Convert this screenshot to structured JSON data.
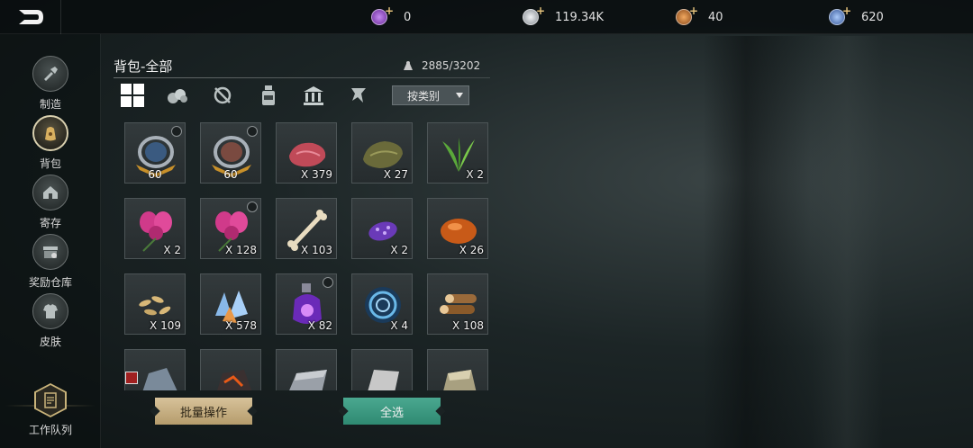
{
  "topbar": {
    "currencies": [
      {
        "icon": "purple-gem-icon",
        "value": "0",
        "color": "#9a5bd0"
      },
      {
        "icon": "silver-coin-icon",
        "value": "119.34K",
        "color": "#c8ccd0"
      },
      {
        "icon": "copper-coin-icon",
        "value": "40",
        "color": "#d08040"
      },
      {
        "icon": "blue-crystal-icon",
        "value": "620",
        "color": "#6a9ad8"
      }
    ]
  },
  "sidebar": {
    "items": [
      {
        "label": "制造",
        "icon": "crafting-icon"
      },
      {
        "label": "背包",
        "icon": "backpack-icon"
      },
      {
        "label": "寄存",
        "icon": "storage-house-icon"
      },
      {
        "label": "奖励仓库",
        "icon": "reward-warehouse-icon"
      },
      {
        "label": "皮肤",
        "icon": "skin-armor-icon"
      }
    ],
    "queue_label": "工作队列"
  },
  "panel": {
    "title": "背包-全部",
    "capacity": "2885/3202",
    "sort_label": "按类别",
    "tabs": [
      "all-grid-icon",
      "materials-icon",
      "equipment-icon",
      "consumables-icon",
      "buildings-icon",
      "misc-icon"
    ]
  },
  "items": [
    {
      "name": "armor-badge-1",
      "label": "60",
      "type": "level"
    },
    {
      "name": "armor-badge-2",
      "label": "60",
      "type": "level"
    },
    {
      "name": "raw-meat",
      "label": "X 379",
      "type": "qty"
    },
    {
      "name": "animal-hide",
      "label": "X 27",
      "type": "qty"
    },
    {
      "name": "green-herb",
      "label": "X 2",
      "type": "qty"
    },
    {
      "name": "pink-orchid",
      "label": "X 2",
      "type": "qty"
    },
    {
      "name": "pink-orchid-2",
      "label": "X 128",
      "type": "qty"
    },
    {
      "name": "bone",
      "label": "X 103",
      "type": "qty"
    },
    {
      "name": "purple-spotted-fruit",
      "label": "X 2",
      "type": "qty"
    },
    {
      "name": "amber-resin",
      "label": "X 26",
      "type": "qty"
    },
    {
      "name": "grain-seeds",
      "label": "X 109",
      "type": "qty"
    },
    {
      "name": "crystal-shards",
      "label": "X 578",
      "type": "qty"
    },
    {
      "name": "purple-potion",
      "label": "X 82",
      "type": "qty"
    },
    {
      "name": "blue-vortex-orb",
      "label": "X 4",
      "type": "qty"
    },
    {
      "name": "wood-logs",
      "label": "X 108",
      "type": "qty"
    },
    {
      "name": "stone-ore",
      "label": "",
      "type": "qty"
    },
    {
      "name": "lava-ore",
      "label": "",
      "type": "qty"
    },
    {
      "name": "iron-ingot",
      "label": "",
      "type": "qty"
    },
    {
      "name": "metal-sheet",
      "label": "",
      "type": "qty"
    },
    {
      "name": "gold-ingot",
      "label": "",
      "type": "qty"
    }
  ],
  "buttons": {
    "batch": "批量操作",
    "select_all": "全选"
  }
}
